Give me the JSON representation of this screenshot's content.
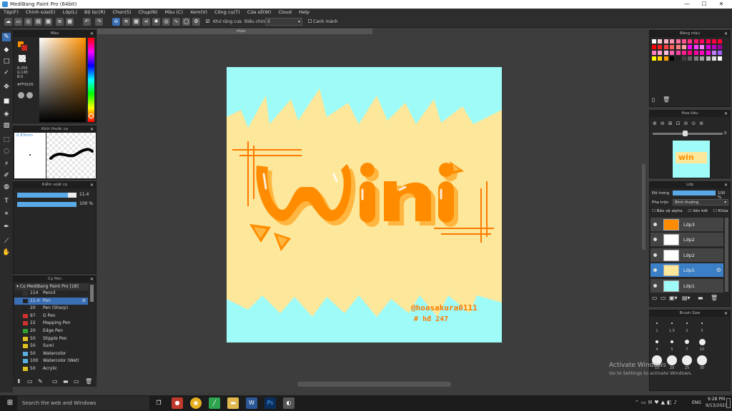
{
  "window": {
    "title": "MediBang Paint Pro (64bit)",
    "controls": [
      "—",
      "☐",
      "✕"
    ]
  },
  "menu": [
    "Tệp(F)",
    "Chỉnh sửa(E)",
    "Lớp(L)",
    "Bộ lọc(R)",
    "Chọn(S)",
    "Chụp(N)",
    "Màu (C)",
    "Xem(V)",
    "Công cụ(T)",
    "Cửa sổ(W)",
    "Cloud",
    "Help"
  ],
  "toolbar": {
    "antialias_label": "Khử răng cưa",
    "correction_label": "Điều chỉnh",
    "correction_value": "0",
    "snap_label": "Canh mảnh"
  },
  "color_panel": {
    "title": "Màu",
    "rgb_r": "R:255",
    "rgb_g": "G:145",
    "rgb_b": "B:0",
    "hex": "#FF9100"
  },
  "brush_size_panel": {
    "title": "Kích thước cọ",
    "size_label": "0.83mm"
  },
  "brush_control_panel": {
    "title": "Kiểm soát cọ",
    "size_value": "11.4",
    "opacity_value": "100 %",
    "size_pct": 0.85,
    "opacity_pct": 1.0
  },
  "brush_list": {
    "title": "Cọ Pen",
    "group": "Cọ MediBang Paint Pro [18]",
    "items": [
      {
        "num": "114",
        "name": "Pencil",
        "color": "#333333"
      },
      {
        "num": "11.4",
        "name": "Pen",
        "color": "#222222",
        "selected": true
      },
      {
        "num": "20",
        "name": "Pen (Sharp)",
        "color": "#222222"
      },
      {
        "num": "97",
        "name": "G Pen",
        "color": "#d03030"
      },
      {
        "num": "22",
        "name": "Mapping Pen",
        "color": "#d03030"
      },
      {
        "num": "20",
        "name": "Edge Pen",
        "color": "#30a030"
      },
      {
        "num": "50",
        "name": "Stipple Pen",
        "color": "#e0c020"
      },
      {
        "num": "50",
        "name": "Sumi",
        "color": "#e0c020"
      },
      {
        "num": "50",
        "name": "Watercolor",
        "color": "#5ab0e0"
      },
      {
        "num": "100",
        "name": "Watercolor (Wet)",
        "color": "#5ab0e0"
      },
      {
        "num": "50",
        "name": "Acrylic",
        "color": "#e0c020"
      }
    ]
  },
  "canvas": {
    "tab_label": "nhọn",
    "signature": "@hoasakura0111",
    "tag": "# hđ 247"
  },
  "palette_panel": {
    "title": "Bảng màu"
  },
  "navigator_panel": {
    "title": "Hoa tiêu",
    "zoom": "0"
  },
  "layer_panel": {
    "title": "Lớp",
    "opacity_label": "Độ trong",
    "opacity_value": "100 %",
    "blend_label": "Pha trộn",
    "blend_value": "Bình thường",
    "protect_alpha": "Bảo vệ alpha",
    "clipping": "Xén bớt",
    "lock": "Khóa",
    "layers": [
      {
        "name": "Lớp3"
      },
      {
        "name": "Lớp2"
      },
      {
        "name": "Lớp2"
      },
      {
        "name": "Lớp5",
        "selected": true
      },
      {
        "name": "Lớp1"
      }
    ]
  },
  "brush_size_presets": {
    "title": "Brush Size",
    "labels": [
      "1",
      "1.5",
      "2",
      "3",
      "4",
      "5",
      "7",
      "10",
      "15",
      "20",
      "25",
      "30"
    ]
  },
  "activation": {
    "line1": "Activate Windows",
    "line2": "Go to Settings to activate Windows."
  },
  "taskbar": {
    "search_placeholder": "Search the web and Windows",
    "lang": "ENG",
    "time": "9:28 PM",
    "date": "9/13/2021"
  }
}
